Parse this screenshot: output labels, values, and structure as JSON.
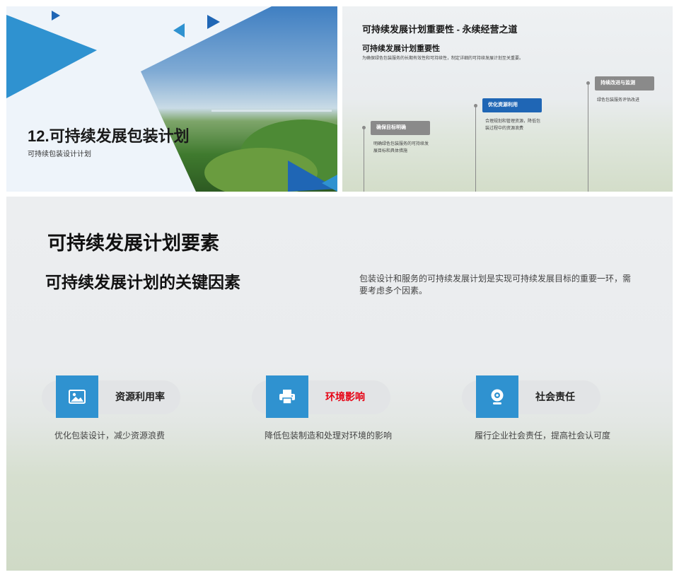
{
  "slide1": {
    "title": "12.可持续发展包装计划",
    "subtitle": "可持续包装设计计划"
  },
  "slide2": {
    "title": "可持续发展计划重要性 - 永续经营之道",
    "subtitle": "可持续发展计划重要性",
    "intro": "为确保绿色包装服务的长期有效性和可持续性，制定详细的可持续发展计划至关重要。",
    "steps": [
      {
        "tag": "确保目标明确",
        "color": "#8a8a8a",
        "desc1": "明确绿色包装服务的可持续发",
        "desc2": "展目标和具体措施"
      },
      {
        "tag": "优化资源利用",
        "color": "#1f66b5",
        "desc1": "合理规划和管理资源，降低包",
        "desc2": "装过程中的资源浪费"
      },
      {
        "tag": "持续改进与监测",
        "color": "#8a8a8a",
        "desc1": "绿色包装服务评估改进",
        "desc2": ""
      }
    ]
  },
  "slide3": {
    "heading": "可持续发展计划要素",
    "subheading": "可持续发展计划的关键因素",
    "intro": "包装设计和服务的可持续发展计划是实现可持续发展目标的重要一环，需要考虑多个因素。",
    "cards": [
      {
        "label": "资源利用率",
        "label_color": "#222222",
        "icon": "image-icon",
        "desc": "优化包装设计，减少资源浪费"
      },
      {
        "label": "环境影响",
        "label_color": "#e60012",
        "icon": "printer-icon",
        "desc": "降低包装制造和处理对环境的影响"
      },
      {
        "label": "社会责任",
        "label_color": "#222222",
        "icon": "webcam-icon",
        "desc": "履行企业社会责任，提高社会认可度"
      }
    ]
  },
  "colors": {
    "accent": "#2f92d0",
    "brand_blue": "#1f66b5"
  }
}
